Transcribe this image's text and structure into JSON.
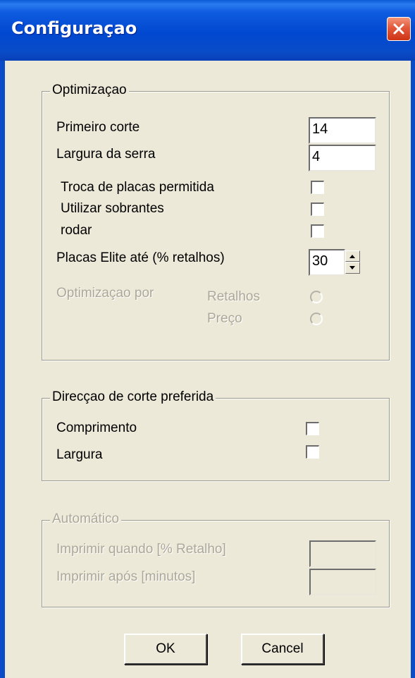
{
  "window": {
    "title": "Configuraçao"
  },
  "optimization": {
    "legend": "Optimizaçao",
    "primeiro_corte": {
      "label": "Primeiro corte",
      "value": "14"
    },
    "largura_serra": {
      "label": "Largura da serra",
      "value": "4"
    },
    "troca_placas": {
      "label": "Troca de placas permitida",
      "checked": false
    },
    "utilizar_sobrantes": {
      "label": "Utilizar sobrantes",
      "checked": false
    },
    "rodar": {
      "label": "rodar",
      "checked": false
    },
    "placas_elite": {
      "label": "Placas Elite até (% retalhos)",
      "value": "30"
    },
    "optimizacao_por": {
      "label": "Optimizaçao por",
      "options": [
        {
          "label": "Retalhos",
          "selected": false
        },
        {
          "label": "Preço",
          "selected": false
        }
      ]
    }
  },
  "direction": {
    "legend": "Direcçao de corte preferida",
    "comprimento": {
      "label": "Comprimento",
      "checked": false
    },
    "largura": {
      "label": "Largura",
      "checked": false
    }
  },
  "automatic": {
    "legend": "Automático",
    "imprimir_quando": {
      "label": "Imprimir quando [% Retalho]",
      "value": ""
    },
    "imprimir_apos": {
      "label": "Imprimir após [minutos]",
      "value": ""
    }
  },
  "buttons": {
    "ok": "OK",
    "cancel": "Cancel"
  },
  "colors": {
    "titlebar": "#0A4CC8",
    "dialog_bg": "#ECE9D8",
    "close_button": "#E2583C",
    "disabled_text": "#ACA899"
  }
}
